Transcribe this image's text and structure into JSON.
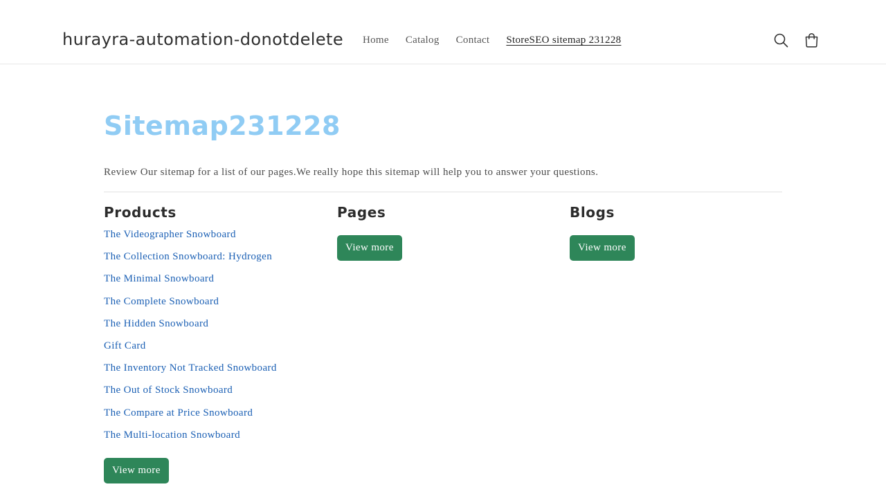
{
  "header": {
    "store_name": "hurayra-automation-donotdelete",
    "nav": [
      {
        "label": "Home",
        "active": false
      },
      {
        "label": "Catalog",
        "active": false
      },
      {
        "label": "Contact",
        "active": false
      },
      {
        "label": "StoreSEO sitemap 231228",
        "active": true
      }
    ],
    "icons": [
      "search-icon",
      "cart-icon"
    ]
  },
  "main": {
    "title": "Sitemap231228",
    "title_color": "#90ccf4",
    "intro": "Review Our sitemap for a list of our pages.We really hope this sitemap will help you to answer your questions.",
    "products": {
      "heading": "Products",
      "items": [
        "The Videographer Snowboard",
        "The Collection Snowboard: Hydrogen",
        "The Minimal Snowboard",
        "The Complete Snowboard",
        "The Hidden Snowboard",
        "Gift Card",
        "The Inventory Not Tracked Snowboard",
        "The Out of Stock Snowboard",
        "The Compare at Price Snowboard",
        "The Multi-location Snowboard"
      ],
      "view_more": "View more"
    },
    "pages": {
      "heading": "Pages",
      "view_more": "View more"
    },
    "blogs": {
      "heading": "Blogs",
      "view_more": "View more"
    }
  },
  "colors": {
    "link": "#1a5fb4",
    "button_bg": "#2e8659",
    "button_text": "#ffffff"
  }
}
